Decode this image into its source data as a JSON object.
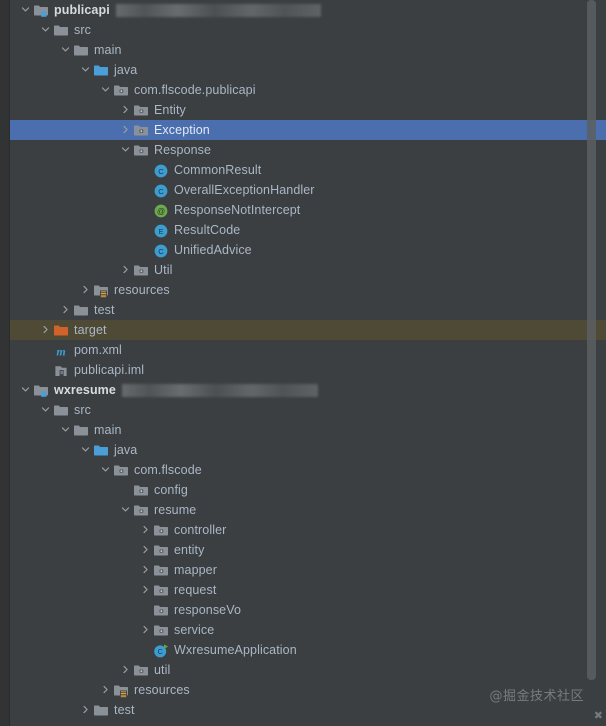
{
  "theme": {
    "background": "#3c3f41",
    "text": "#a9b7c6",
    "selection": "#4b6eaf",
    "hover": "#4e4a35",
    "folder_grey": "#9aa7b0",
    "folder_blue": "#4a9fd8",
    "folder_orange": "#cc7832",
    "class_blue": "#3c9dd0",
    "annotation_green": "#6ea84f"
  },
  "watermark": {
    "text": "@掘金技术社区"
  },
  "tree": {
    "rows": [
      {
        "depth": 0,
        "arrow": "down",
        "icon": "module-icon",
        "label": "publicapi",
        "bold": true,
        "state": "normal",
        "redact": 205
      },
      {
        "depth": 1,
        "arrow": "down",
        "icon": "folder-icon",
        "label": "src",
        "bold": false,
        "state": "normal"
      },
      {
        "depth": 2,
        "arrow": "down",
        "icon": "folder-icon",
        "label": "main",
        "bold": false,
        "state": "normal"
      },
      {
        "depth": 3,
        "arrow": "down",
        "icon": "sources-root-icon",
        "label": "java",
        "bold": false,
        "state": "normal"
      },
      {
        "depth": 4,
        "arrow": "down",
        "icon": "package-icon",
        "label": "com.flscode.publicapi",
        "bold": false,
        "state": "normal"
      },
      {
        "depth": 5,
        "arrow": "right",
        "icon": "package-icon",
        "label": "Entity",
        "bold": false,
        "state": "normal"
      },
      {
        "depth": 5,
        "arrow": "right",
        "icon": "package-icon",
        "label": "Exception",
        "bold": false,
        "state": "selected"
      },
      {
        "depth": 5,
        "arrow": "down",
        "icon": "package-icon",
        "label": "Response",
        "bold": false,
        "state": "normal"
      },
      {
        "depth": 6,
        "arrow": "none",
        "icon": "class-icon",
        "label": "CommonResult",
        "bold": false,
        "state": "normal"
      },
      {
        "depth": 6,
        "arrow": "none",
        "icon": "class-icon",
        "label": "OverallExceptionHandler",
        "bold": false,
        "state": "normal"
      },
      {
        "depth": 6,
        "arrow": "none",
        "icon": "annotation-icon",
        "label": "ResponseNotIntercept",
        "bold": false,
        "state": "normal"
      },
      {
        "depth": 6,
        "arrow": "none",
        "icon": "enum-icon",
        "label": "ResultCode",
        "bold": false,
        "state": "normal"
      },
      {
        "depth": 6,
        "arrow": "none",
        "icon": "class-icon",
        "label": "UnifiedAdvice",
        "bold": false,
        "state": "normal"
      },
      {
        "depth": 5,
        "arrow": "right",
        "icon": "package-icon",
        "label": "Util",
        "bold": false,
        "state": "normal"
      },
      {
        "depth": 3,
        "arrow": "right",
        "icon": "resources-root-icon",
        "label": "resources",
        "bold": false,
        "state": "normal"
      },
      {
        "depth": 2,
        "arrow": "right",
        "icon": "folder-icon",
        "label": "test",
        "bold": false,
        "state": "normal"
      },
      {
        "depth": 1,
        "arrow": "right",
        "icon": "target-folder-icon",
        "label": "target",
        "bold": false,
        "state": "hovered"
      },
      {
        "depth": 1,
        "arrow": "none",
        "icon": "maven-icon",
        "label": "pom.xml",
        "bold": false,
        "state": "normal"
      },
      {
        "depth": 1,
        "arrow": "none",
        "icon": "iml-icon",
        "label": "publicapi.iml",
        "bold": false,
        "state": "normal"
      },
      {
        "depth": 0,
        "arrow": "down",
        "icon": "module-icon",
        "label": "wxresume",
        "bold": true,
        "state": "normal",
        "redact": 196
      },
      {
        "depth": 1,
        "arrow": "down",
        "icon": "folder-icon",
        "label": "src",
        "bold": false,
        "state": "normal"
      },
      {
        "depth": 2,
        "arrow": "down",
        "icon": "folder-icon",
        "label": "main",
        "bold": false,
        "state": "normal"
      },
      {
        "depth": 3,
        "arrow": "down",
        "icon": "sources-root-icon",
        "label": "java",
        "bold": false,
        "state": "normal"
      },
      {
        "depth": 4,
        "arrow": "down",
        "icon": "package-icon",
        "label": "com.flscode",
        "bold": false,
        "state": "normal"
      },
      {
        "depth": 5,
        "arrow": "none",
        "icon": "package-icon",
        "label": "config",
        "bold": false,
        "state": "normal"
      },
      {
        "depth": 5,
        "arrow": "down",
        "icon": "package-icon",
        "label": "resume",
        "bold": false,
        "state": "normal"
      },
      {
        "depth": 6,
        "arrow": "right",
        "icon": "package-icon",
        "label": "controller",
        "bold": false,
        "state": "normal"
      },
      {
        "depth": 6,
        "arrow": "right",
        "icon": "package-icon",
        "label": "entity",
        "bold": false,
        "state": "normal"
      },
      {
        "depth": 6,
        "arrow": "right",
        "icon": "package-icon",
        "label": "mapper",
        "bold": false,
        "state": "normal"
      },
      {
        "depth": 6,
        "arrow": "right",
        "icon": "package-icon",
        "label": "request",
        "bold": false,
        "state": "normal"
      },
      {
        "depth": 6,
        "arrow": "none",
        "icon": "package-icon",
        "label": "responseVo",
        "bold": false,
        "state": "normal"
      },
      {
        "depth": 6,
        "arrow": "right",
        "icon": "package-icon",
        "label": "service",
        "bold": false,
        "state": "normal"
      },
      {
        "depth": 6,
        "arrow": "none",
        "icon": "runnable-class-icon",
        "label": "WxresumeApplication",
        "bold": false,
        "state": "normal"
      },
      {
        "depth": 5,
        "arrow": "right",
        "icon": "package-icon",
        "label": "util",
        "bold": false,
        "state": "normal"
      },
      {
        "depth": 4,
        "arrow": "right",
        "icon": "resources-root-icon",
        "label": "resources",
        "bold": false,
        "state": "normal"
      },
      {
        "depth": 3,
        "arrow": "right",
        "icon": "folder-icon",
        "label": "test",
        "bold": false,
        "state": "normal"
      }
    ]
  }
}
